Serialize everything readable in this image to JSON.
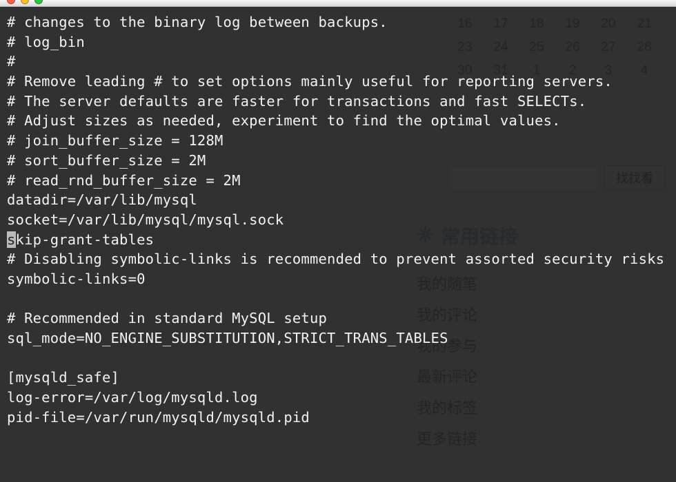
{
  "titlebar": {
    "lights": [
      "red",
      "yellow",
      "green"
    ]
  },
  "calendar": {
    "rows": [
      [
        "16",
        "17",
        "18",
        "19",
        "20",
        "21"
      ],
      [
        "23",
        "24",
        "25",
        "26",
        "27",
        "28"
      ],
      [
        "30",
        "31",
        "1",
        "2",
        "3",
        "4"
      ]
    ]
  },
  "search": {
    "placeholder": "",
    "button_label": "找找看"
  },
  "links": {
    "header_icon": "✳",
    "header_text": "常用链接",
    "items": [
      "我的随笔",
      "我的评论",
      "我的参与",
      "最新评论",
      "我的标签",
      "更多链接"
    ]
  },
  "terminal": {
    "lines": [
      "# changes to the binary log between backups.",
      "# log_bin",
      "#",
      "# Remove leading # to set options mainly useful for reporting servers.",
      "# The server defaults are faster for transactions and fast SELECTs.",
      "# Adjust sizes as needed, experiment to find the optimal values.",
      "# join_buffer_size = 128M",
      "# sort_buffer_size = 2M",
      "# read_rnd_buffer_size = 2M",
      "datadir=/var/lib/mysql",
      "socket=/var/lib/mysql/mysql.sock",
      "",
      "# Disabling symbolic-links is recommended to prevent assorted security risks",
      "symbolic-links=0",
      "",
      "# Recommended in standard MySQL setup",
      "sql_mode=NO_ENGINE_SUBSTITUTION,STRICT_TRANS_TABLES ",
      "",
      "[mysqld_safe]",
      "log-error=/var/log/mysqld.log",
      "pid-file=/var/run/mysqld/mysqld.pid"
    ],
    "highlighted_line": {
      "sel_prefix": "s",
      "rest": "kip-grant-tables"
    }
  }
}
